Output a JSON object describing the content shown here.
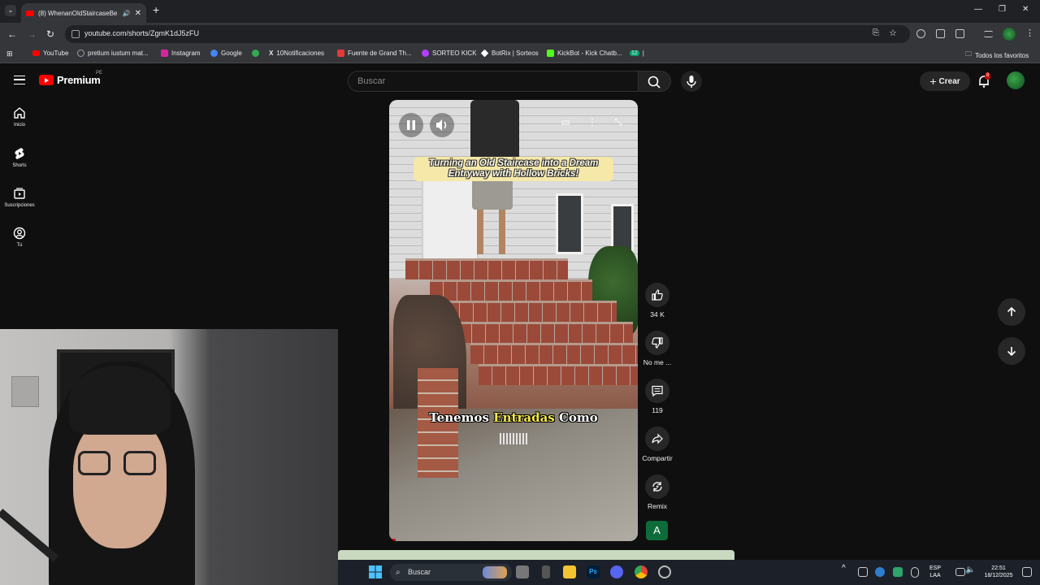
{
  "browser": {
    "tab_title": "(8) WhenanOldStaircaseBe",
    "url": "youtube.com/shorts/ZgmK1dJ5zFU",
    "bookmarks": [
      {
        "label": "YouTube",
        "color": "#ff0000"
      },
      {
        "label": "pretium iustum mat...",
        "color": "#9aa0a6"
      },
      {
        "label": "Instagram",
        "color": "#d6249f"
      },
      {
        "label": "Google",
        "color": "#4285f4"
      },
      {
        "label": "",
        "color": "#34a853"
      },
      {
        "label": "10Notificaciones",
        "color": "#ffffff"
      },
      {
        "label": "Fuente de Grand Th...",
        "color": "#e53935"
      },
      {
        "label": "SORTEO KICK",
        "color": "#b040ff"
      },
      {
        "label": "BotRix | Sorteos",
        "color": "#ffffff"
      },
      {
        "label": "KickBot - Kick Chatb...",
        "color": "#53fc18"
      },
      {
        "label": "12",
        "color": "#00a36c"
      }
    ],
    "all_bookmarks": "Todos los favoritos"
  },
  "header": {
    "brand": "Premium",
    "region": "PE",
    "search_placeholder": "Buscar",
    "create_label": "Crear",
    "notifications": "8"
  },
  "sidebar": {
    "items": [
      {
        "label": "Inicio",
        "icon": "home-icon"
      },
      {
        "label": "Shorts",
        "icon": "shorts-icon"
      },
      {
        "label": "Suscripciones",
        "icon": "subscriptions-icon"
      },
      {
        "label": "Tú",
        "icon": "you-icon"
      }
    ]
  },
  "video": {
    "caption": "Turning an Old Staircase into a Dream Entryway with Hollow Bricks!",
    "subtitle_pre": "Tenemos ",
    "subtitle_highlight": "Entradas",
    "subtitle_post": " Como"
  },
  "actions": {
    "likes": "34 K",
    "dislike": "No me ...",
    "comments": "119",
    "share": "Compartir",
    "remix": "Remix",
    "channel_letter": "A"
  },
  "taskbar": {
    "search": "Buscar",
    "lang1": "ESP",
    "lang2": "LAA",
    "time": "22:51",
    "date": "18/12/2025"
  },
  "colors": {
    "background": "#0f0f0f",
    "accent": "#ff0000"
  }
}
